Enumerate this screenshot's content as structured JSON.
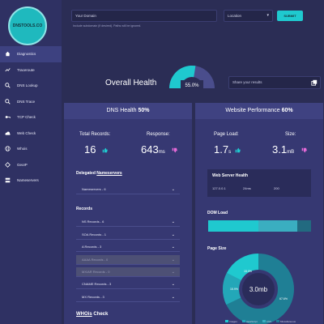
{
  "logo": {
    "text": "DNSTOOLS.CO"
  },
  "sidebar": {
    "items": [
      {
        "label": "Diagnostics",
        "icon": "home-icon"
      },
      {
        "label": "Traceroute",
        "icon": "route-icon"
      },
      {
        "label": "DNS Lookup",
        "icon": "search-icon"
      },
      {
        "label": "DNS Trace",
        "icon": "search-icon"
      },
      {
        "label": "TCP Check",
        "icon": "key-icon"
      },
      {
        "label": "Web Check",
        "icon": "cloud-icon"
      },
      {
        "label": "Whois",
        "icon": "globe-icon"
      },
      {
        "label": "GeoIP",
        "icon": "diamond-icon"
      },
      {
        "label": "Nameservers",
        "icon": "server-icon"
      }
    ]
  },
  "search": {
    "domain_placeholder": "Your Domain",
    "location_placeholder": "Location",
    "submit_label": "SUBMIT",
    "hint": "Include subdomain (if desired). Paths will be ignored."
  },
  "overall": {
    "label": "Overall Health",
    "percent": "55.0%",
    "value": 0.55
  },
  "share": {
    "placeholder": "Share your results"
  },
  "dns_panel": {
    "title": "DNS Health",
    "percent": "50%",
    "records_label": "Total Records:",
    "records_value": "16",
    "response_label": "Response:",
    "response_value": "643",
    "response_unit": "ms",
    "delegated_prefix": "Delegated ",
    "delegated_link": "Nameservers",
    "nameservers_row": "Nameservers - 6",
    "records_title": "Records",
    "records": [
      {
        "label": "NS Records - 6",
        "disabled": false
      },
      {
        "label": "SOA Records - 1",
        "disabled": false
      },
      {
        "label": "A Records - 3",
        "disabled": false
      },
      {
        "label": "AAAA Records - 0",
        "disabled": true
      },
      {
        "label": "MX/AR Records - 0",
        "disabled": true
      },
      {
        "label": "CNAME Records - 3",
        "disabled": false
      },
      {
        "label": "MX Records - 3",
        "disabled": false
      }
    ],
    "whois_link": "WHOis",
    "whois_suffix": " Check"
  },
  "web_panel": {
    "title": "Website Performance",
    "percent": "60%",
    "load_label": "Page Load:",
    "load_value": "1.7",
    "load_unit": "s",
    "size_label": "Size:",
    "size_value": "3.1",
    "size_unit": "mB",
    "server_title": "Web Server Health",
    "server_ip": "127.0.0.1",
    "server_ms": "24ms",
    "server_code": "200",
    "dom_title": "DOM Load",
    "page_size_title": "Page Size",
    "donut_center": "3.0mb",
    "donut_labels": [
      "15.0%",
      "15.9%",
      "67.6%"
    ],
    "legend": [
      "Images",
      "JavaScript",
      "CSS",
      "Miscellaneous"
    ]
  },
  "colors": {
    "accent": "#1fc9cf",
    "good": "#1fc9cf",
    "bad": "#e86bd9"
  }
}
